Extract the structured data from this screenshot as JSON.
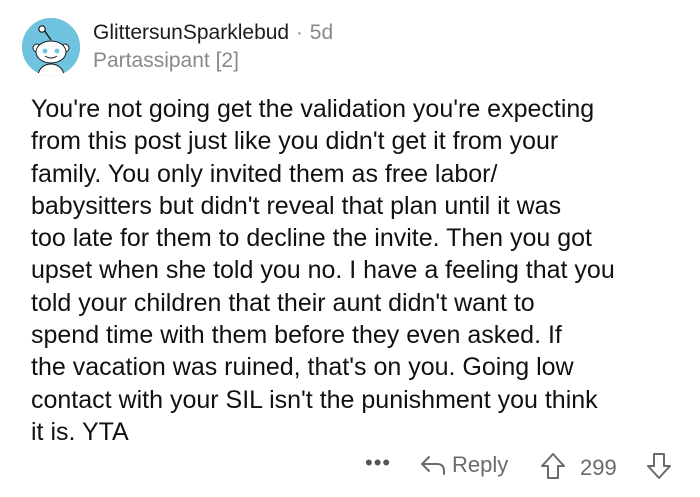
{
  "comment": {
    "username": "GlittersunSparklebud",
    "separator": "·",
    "age": "5d",
    "flair": "Partassipant [2]",
    "body": "You're not going get the validation you're expecting\nfrom this post just like you didn't get it from your\nfamily.  You only invited them as free labor/\nbabysitters but didn't reveal that plan until it was\ntoo late for them to decline the invite.  Then you got\nupset when she told you no. I have a feeling that you\ntold your children that their aunt didn't want to\nspend time with them before they even asked.  If\nthe vacation was ruined,  that's on you. Going low\ncontact with your SIL isn't the punishment you think\nit is. YTA"
  },
  "actions": {
    "more_label": "•••",
    "reply_label": "Reply",
    "score": "299"
  },
  "colors": {
    "avatar_bg": "#6fc3df",
    "muted_text": "#878a8c",
    "action_text": "#6b6b6b"
  },
  "icons": [
    "snoo-avatar-icon",
    "reply-arrow-icon",
    "upvote-arrow-icon",
    "downvote-arrow-icon"
  ]
}
